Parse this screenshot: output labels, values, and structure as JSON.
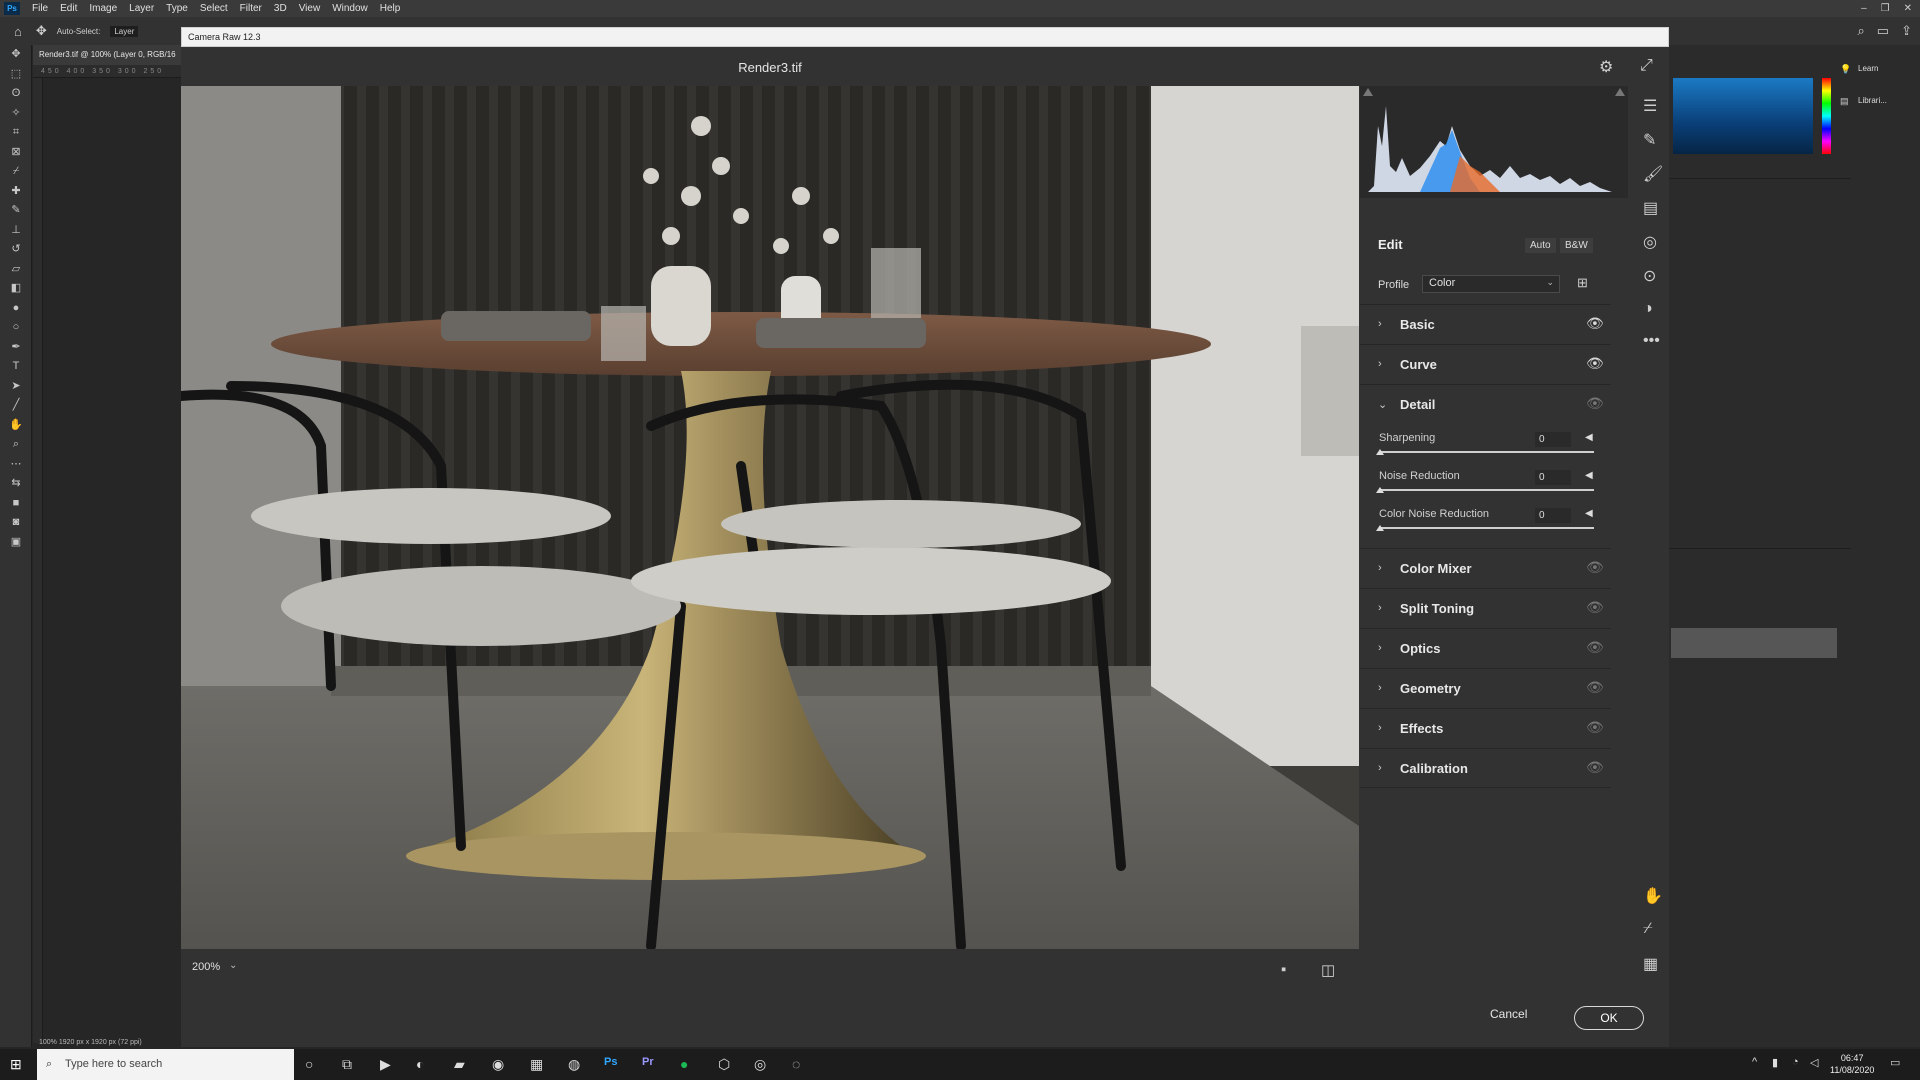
{
  "ps": {
    "logo": "Ps",
    "menu": [
      "File",
      "Edit",
      "Image",
      "Layer",
      "Type",
      "Select",
      "Filter",
      "3D",
      "View",
      "Window",
      "Help"
    ],
    "options": {
      "auto_select": "Auto-Select:",
      "layer": "Layer"
    },
    "doc_tab": "Render3.tif @ 100% (Layer 0, RGB/16",
    "ruler": "450 400 350 300 250",
    "status": "100%     1920 px x 1920 px (72 ppi)",
    "right_panel": {
      "learn": "Learn",
      "libraries": "Librari..."
    }
  },
  "camera_raw": {
    "window_title": "Camera Raw 12.3",
    "filename": "Render3.tif",
    "zoom": "200%",
    "cancel": "Cancel",
    "ok": "OK",
    "edit": {
      "title": "Edit",
      "auto": "Auto",
      "bw": "B&W",
      "profile_label": "Profile",
      "profile_value": "Color",
      "sections_top": [
        {
          "label": "Basic",
          "eye": "visible"
        },
        {
          "label": "Curve",
          "eye": "visible"
        }
      ],
      "detail": {
        "label": "Detail",
        "sliders": [
          {
            "label": "Sharpening",
            "value": "0"
          },
          {
            "label": "Noise Reduction",
            "value": "0"
          },
          {
            "label": "Color Noise Reduction",
            "value": "0"
          }
        ]
      },
      "sections_bottom": [
        {
          "label": "Color Mixer"
        },
        {
          "label": "Split Toning"
        },
        {
          "label": "Optics"
        },
        {
          "label": "Geometry"
        },
        {
          "label": "Effects"
        },
        {
          "label": "Calibration"
        }
      ]
    }
  },
  "taskbar": {
    "search_placeholder": "Type here to search",
    "time": "06:47",
    "date": "11/08/2020"
  },
  "colors": {
    "accent": "#31a8ff",
    "ok_border": "#d8d8d8"
  }
}
